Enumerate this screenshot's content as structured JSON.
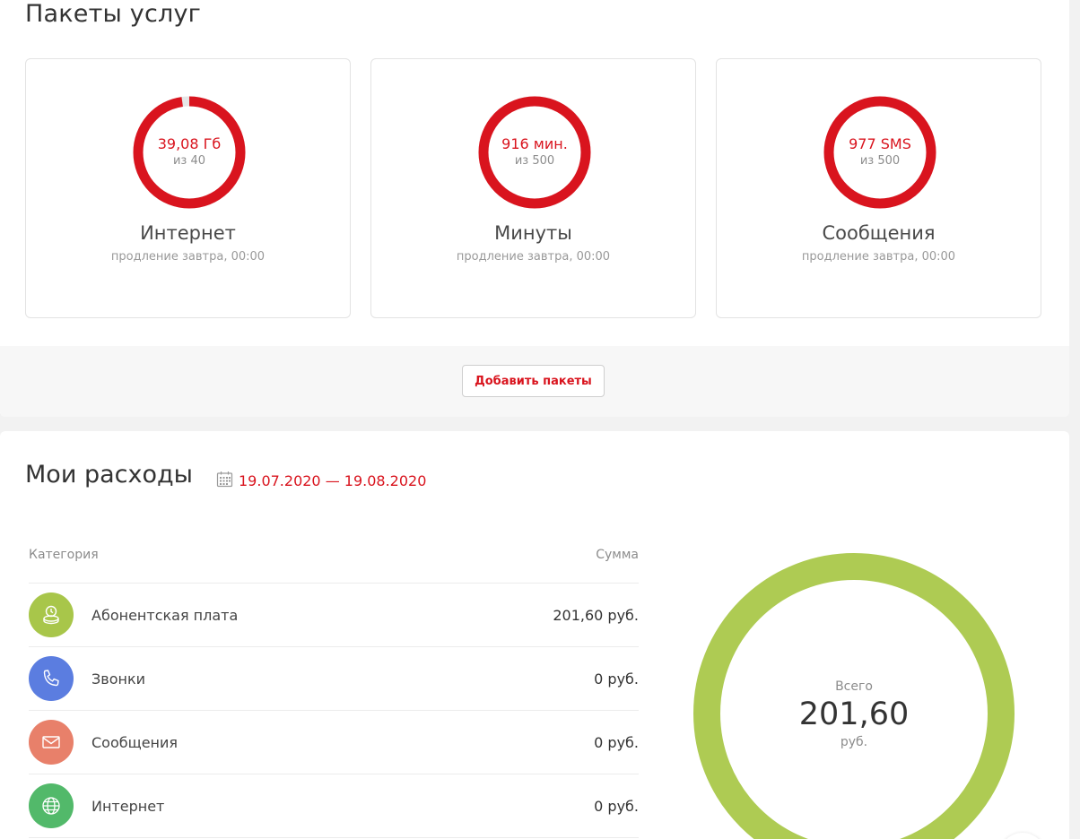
{
  "packages": {
    "title": "Пакеты услуг",
    "items": [
      {
        "amount": "39,08 Гб",
        "of": "из 40",
        "name": "Интернет",
        "renewal": "продление завтра, 00:00",
        "fill_fraction": 0.977
      },
      {
        "amount": "916 мин.",
        "of": "из 500",
        "name": "Минуты",
        "renewal": "продление завтра, 00:00",
        "fill_fraction": 1.0
      },
      {
        "amount": "977 SMS",
        "of": "из 500",
        "name": "Сообщения",
        "renewal": "продление завтра, 00:00",
        "fill_fraction": 1.0
      }
    ],
    "add_button_label": "Добавить пакеты"
  },
  "expenses": {
    "title": "Мои расходы",
    "period": "19.07.2020 — 19.08.2020",
    "table": {
      "header_category": "Категория",
      "header_sum": "Сумма",
      "rows": [
        {
          "label": "Абонентская плата",
          "sum": "201,60 руб.",
          "icon": "coins-icon",
          "color": "#a8c64a"
        },
        {
          "label": "Звонки",
          "sum": "0 руб.",
          "icon": "phone-icon",
          "color": "#5b7de0"
        },
        {
          "label": "Сообщения",
          "sum": "0 руб.",
          "icon": "envelope-icon",
          "color": "#e8806a"
        },
        {
          "label": "Интернет",
          "sum": "0 руб.",
          "icon": "globe-icon",
          "color": "#52b96a"
        }
      ]
    },
    "total": {
      "label": "Всего",
      "value": "201,60",
      "unit": "руб."
    }
  },
  "colors": {
    "accent_red": "#d9141e",
    "ring_track": "#e6e6e6",
    "total_ring": "#aecb53"
  }
}
